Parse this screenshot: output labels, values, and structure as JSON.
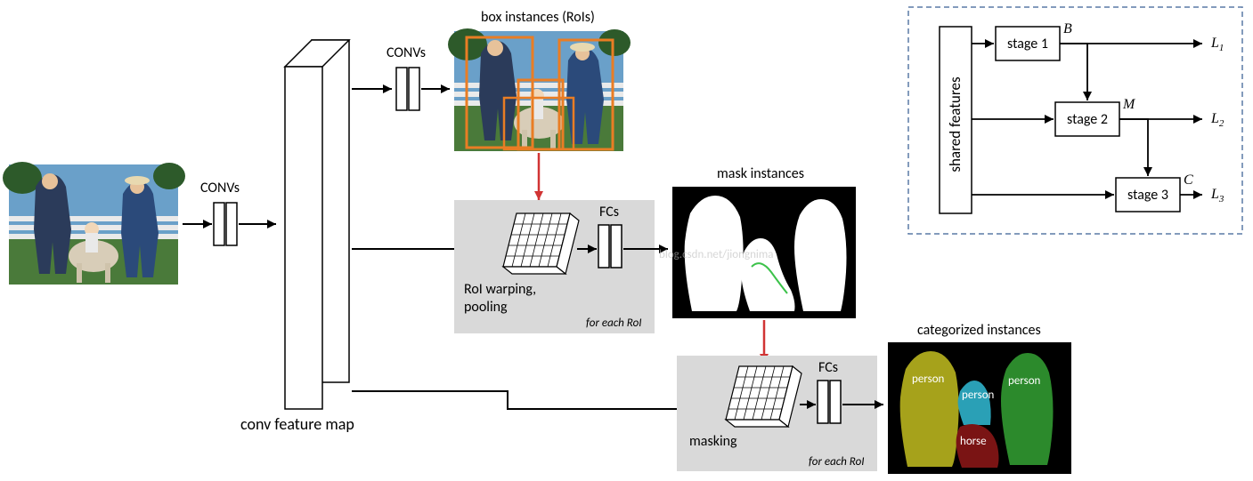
{
  "labels": {
    "convs1": "CONVs",
    "convs2": "CONVs",
    "conv_feature_map": "conv feature map",
    "box_instances": "box instances (RoIs)",
    "mask_instances": "mask instances",
    "categorized_instances": "categorized instances",
    "roi_warping": "RoI warping,",
    "roi_pooling": "pooling",
    "for_each_roi1": "for each RoI",
    "for_each_roi2": "for each RoI",
    "masking": "masking",
    "fcs1": "FCs",
    "fcs2": "FCs",
    "shared_features": "shared features",
    "stage1": "stage 1",
    "stage2": "stage 2",
    "stage3": "stage 3",
    "B": "B",
    "M": "M",
    "C": "C",
    "L1": "L",
    "L1_sub": "1",
    "L2": "L",
    "L2_sub": "2",
    "L3": "L",
    "L3_sub": "3",
    "watermark": "blog.csdn.net/jiongnima",
    "cat_person1": "person",
    "cat_person2": "person",
    "cat_person3": "person",
    "cat_horse": "horse"
  },
  "colors": {
    "orange": "#e97d24",
    "red": "#d13434",
    "grass": "#4a7a3a",
    "sky": "#6aa0c9",
    "fence": "#eaeaea",
    "mask_bg": "#000",
    "mask_fg": "#fff",
    "mask_outline": "#3cc24a",
    "olive": "#a6a21b",
    "teal": "#2aa0b6",
    "green": "#2c8a2c",
    "darkred": "#7a1414",
    "gray": "#d9d9d9",
    "dashBorder": "#5a7aa6"
  }
}
